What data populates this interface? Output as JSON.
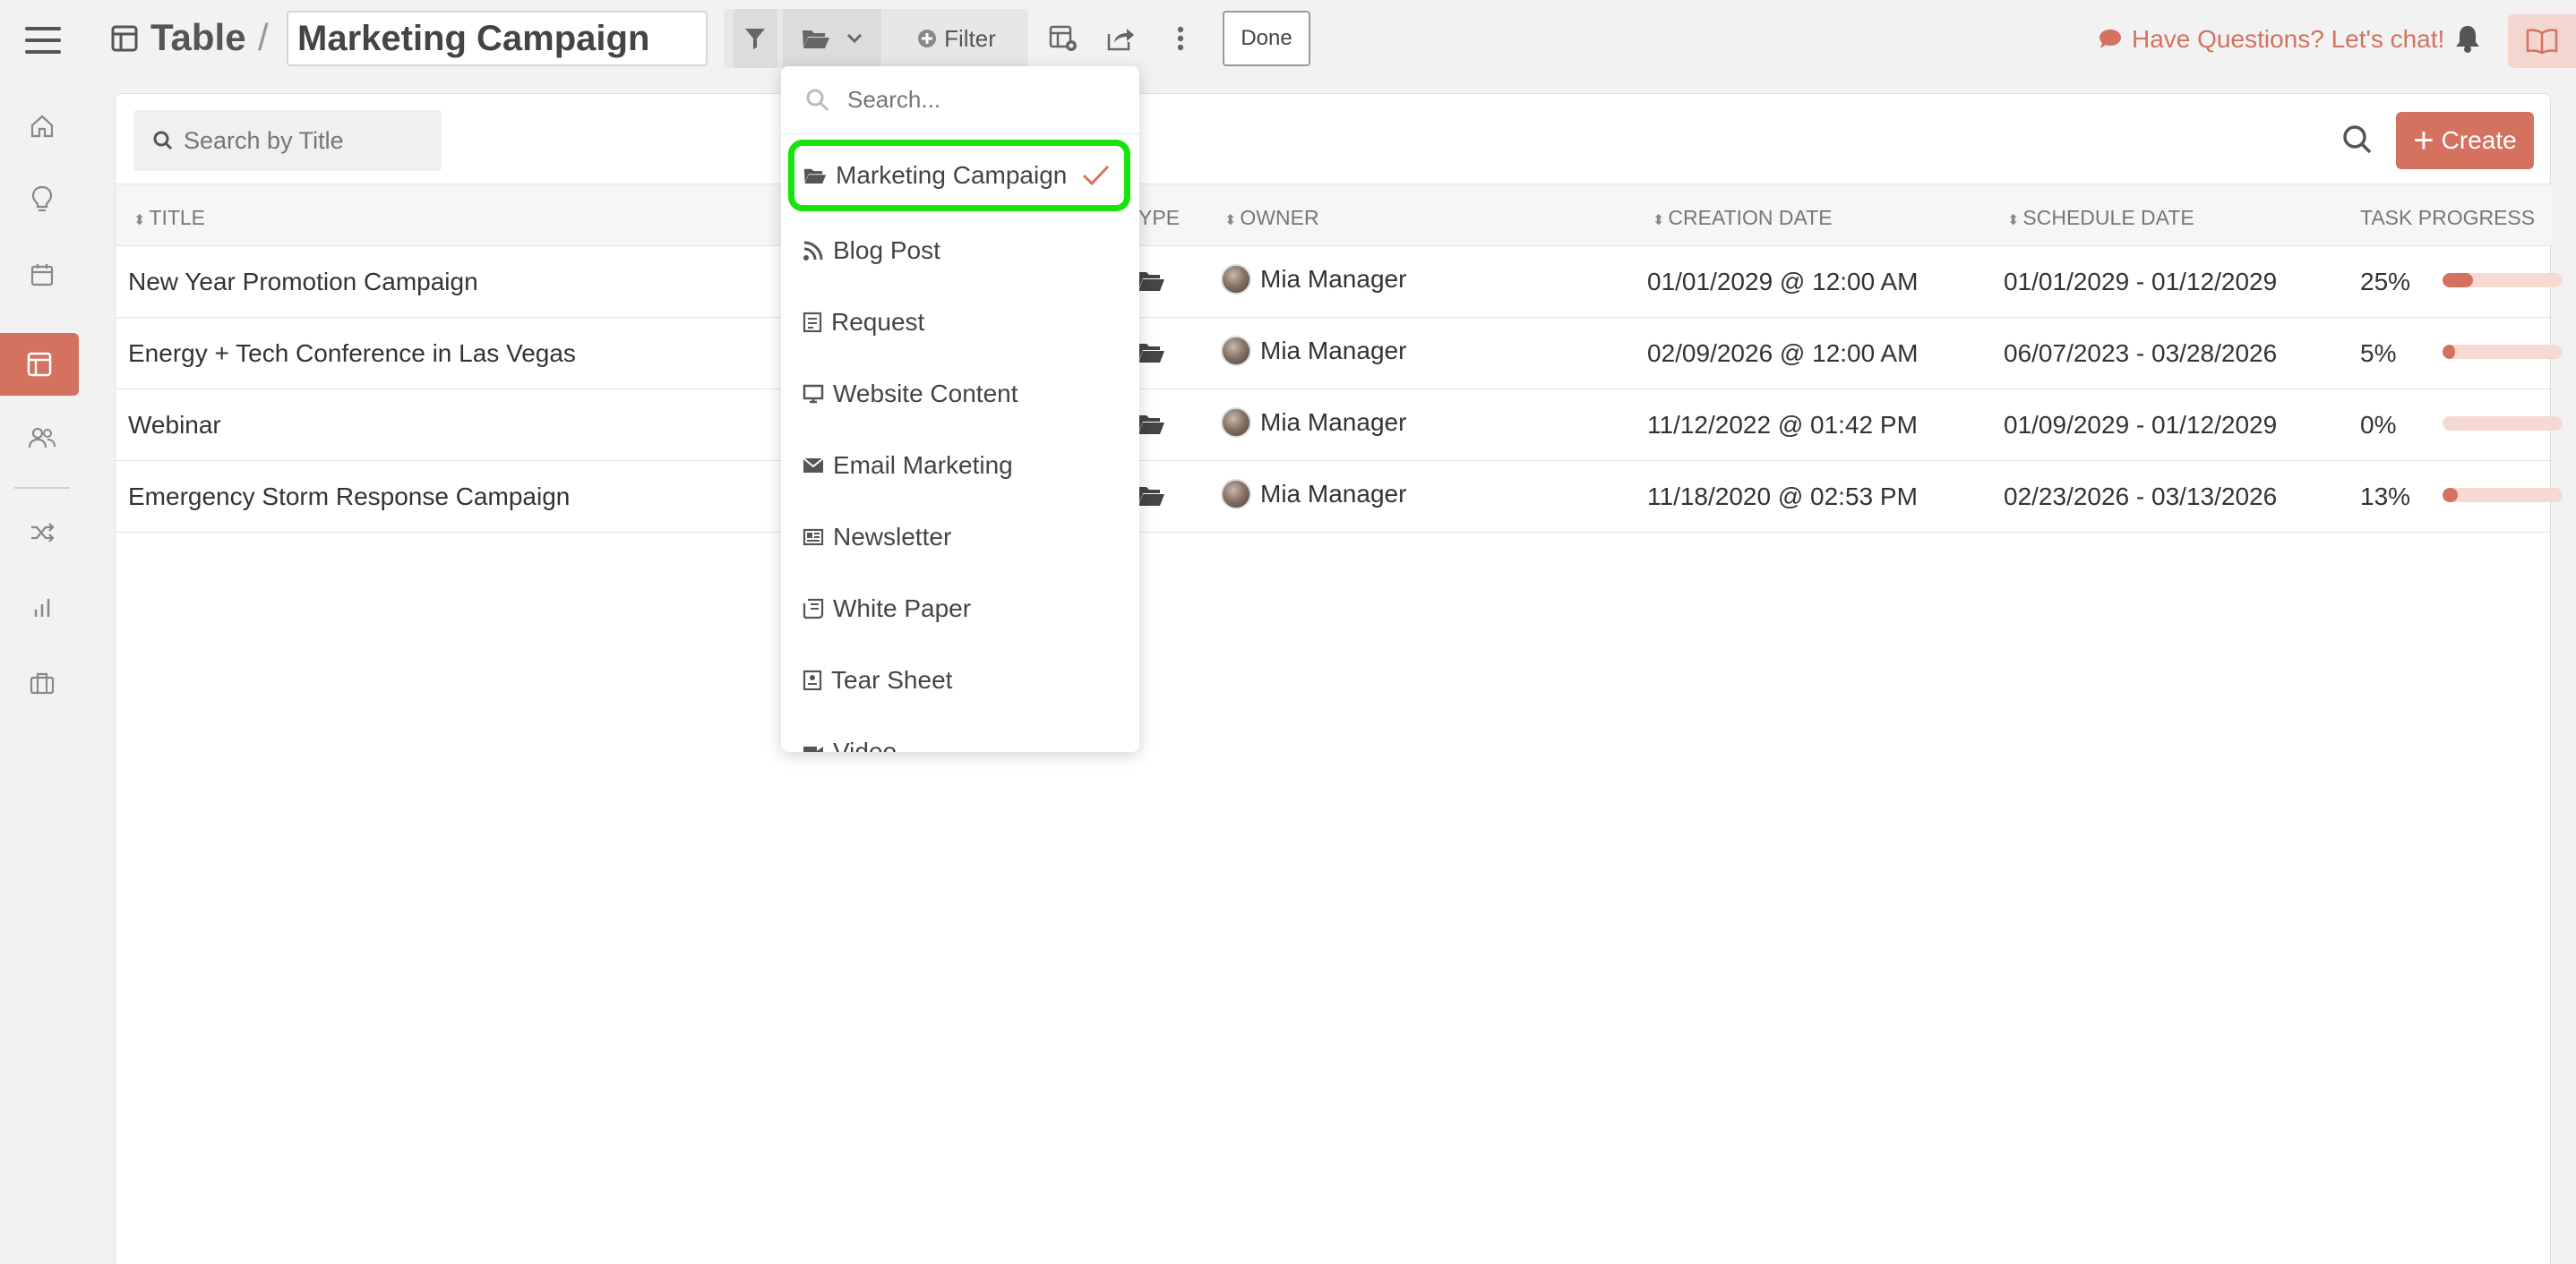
{
  "header": {
    "page_type": "Table",
    "separator": "/",
    "title_value": "Marketing Campaign",
    "filter_label": "Filter",
    "done_label": "Done",
    "help_label": "Have Questions? Let's chat!"
  },
  "sidebar": {
    "items": [
      {
        "name": "home-icon"
      },
      {
        "name": "lightbulb-icon"
      },
      {
        "name": "calendar-icon"
      },
      {
        "name": "table-icon",
        "active": true
      },
      {
        "name": "users-icon"
      },
      {
        "name": "shuffle-icon"
      },
      {
        "name": "bar-chart-icon"
      },
      {
        "name": "briefcase-icon"
      }
    ]
  },
  "toolbar": {
    "search_placeholder": "Search by Title",
    "create_label": "Create"
  },
  "table": {
    "columns": [
      "TITLE",
      "TYPE",
      "OWNER",
      "CREATION DATE",
      "SCHEDULE DATE",
      "TASK PROGRESS"
    ],
    "rows": [
      {
        "title": "New Year Promotion Campaign",
        "owner": "Mia Manager",
        "created": "01/01/2029 @ 12:00 AM",
        "schedule": "01/01/2029 - 01/12/2029",
        "progress_label": "25%",
        "progress": 25
      },
      {
        "title": "Energy + Tech Conference in Las Vegas",
        "owner": "Mia Manager",
        "created": "02/09/2026 @ 12:00 AM",
        "schedule": "06/07/2023 - 03/28/2026",
        "progress_label": "5%",
        "progress": 5
      },
      {
        "title": "Webinar",
        "owner": "Mia Manager",
        "created": "11/12/2022 @ 01:42 PM",
        "schedule": "01/09/2029 - 01/12/2029",
        "progress_label": "0%",
        "progress": 0
      },
      {
        "title": "Emergency Storm Response Campaign",
        "owner": "Mia Manager",
        "created": "11/18/2020 @ 02:53 PM",
        "schedule": "02/23/2026 - 03/13/2026",
        "progress_label": "13%",
        "progress": 13
      }
    ]
  },
  "dropdown": {
    "search_placeholder": "Search...",
    "items": [
      {
        "label": "Marketing Campaign",
        "icon": "folder-open-icon",
        "selected": true
      },
      {
        "label": "Blog Post",
        "icon": "rss-icon"
      },
      {
        "label": "Request",
        "icon": "note-icon"
      },
      {
        "label": "Website Content",
        "icon": "monitor-icon"
      },
      {
        "label": "Email Marketing",
        "icon": "envelope-icon"
      },
      {
        "label": "Newsletter",
        "icon": "newspaper-icon"
      },
      {
        "label": "White Paper",
        "icon": "paper-icon"
      },
      {
        "label": "Tear Sheet",
        "icon": "tear-sheet-icon"
      },
      {
        "label": "Video",
        "icon": "video-icon"
      }
    ]
  },
  "colors": {
    "accent": "#d4725f",
    "selection_highlight": "#19e30d",
    "progress_track": "#f6d9d2"
  }
}
